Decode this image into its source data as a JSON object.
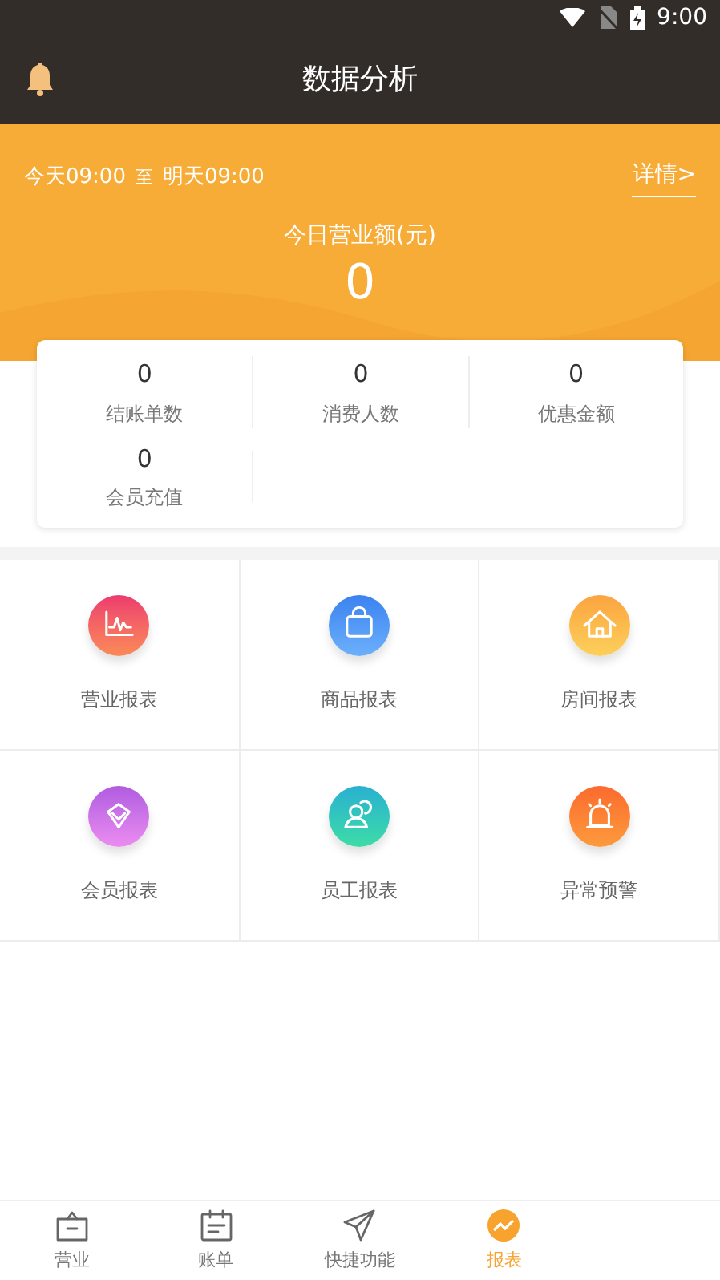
{
  "status_bar": {
    "time": "9:00"
  },
  "header": {
    "title": "数据分析"
  },
  "banner": {
    "range_start": "今天09:00",
    "range_sep": "至",
    "range_end": "明天09:00",
    "details_link": "详情>",
    "revenue_label": "今日营业额(元)",
    "revenue_value": "0"
  },
  "stats": [
    {
      "value": "0",
      "label": "结账单数"
    },
    {
      "value": "0",
      "label": "消费人数"
    },
    {
      "value": "0",
      "label": "优惠金额"
    },
    {
      "value": "0",
      "label": "会员充值"
    }
  ],
  "reports": [
    {
      "label": "营业报表",
      "kind": "chart"
    },
    {
      "label": "商品报表",
      "kind": "bag"
    },
    {
      "label": "房间报表",
      "kind": "house"
    },
    {
      "label": "会员报表",
      "kind": "diamond"
    },
    {
      "label": "员工报表",
      "kind": "people"
    },
    {
      "label": "异常预警",
      "kind": "alarm"
    }
  ],
  "tab_bar": [
    {
      "label": "营业",
      "kind": "shop",
      "selected": false
    },
    {
      "label": "账单",
      "kind": "bill",
      "selected": false
    },
    {
      "label": "快捷功能",
      "kind": "send",
      "selected": false
    },
    {
      "label": "报表",
      "kind": "report",
      "selected": true
    }
  ]
}
